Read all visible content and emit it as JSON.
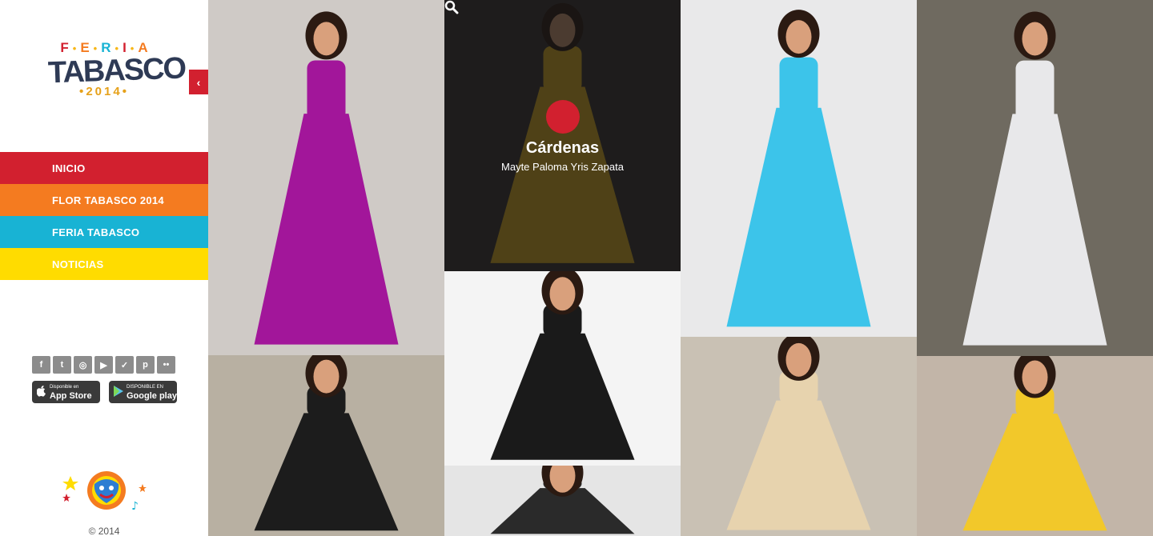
{
  "logo": {
    "feria_letters": [
      "F",
      "E",
      "R",
      "I",
      "A"
    ],
    "feria_colors": [
      "#d2202f",
      "#f47b20",
      "#18b3d4",
      "#d2202f",
      "#f47b20"
    ],
    "title": "TABASCO",
    "year": "2014"
  },
  "sidebar": {
    "collapse_icon": "‹",
    "nav": [
      {
        "label": "INICIO",
        "color": "#d2202f"
      },
      {
        "label": "FLOR TABASCO 2014",
        "color": "#f47b20"
      },
      {
        "label": "FERIA TABASCO",
        "color": "#18b3d4"
      },
      {
        "label": "NOTICIAS",
        "color": "#ffdc00"
      }
    ],
    "socials": [
      {
        "name": "facebook-icon",
        "glyph": "f"
      },
      {
        "name": "twitter-icon",
        "glyph": "t"
      },
      {
        "name": "instagram-icon",
        "glyph": "◎"
      },
      {
        "name": "youtube-icon",
        "glyph": "▶"
      },
      {
        "name": "foursquare-icon",
        "glyph": "✓"
      },
      {
        "name": "pinterest-icon",
        "glyph": "p"
      },
      {
        "name": "flickr-icon",
        "glyph": "••"
      }
    ],
    "stores": [
      {
        "small": "Disponible en",
        "big": "App Store",
        "icon": ""
      },
      {
        "small": "DISPONIBLE EN",
        "big": "Google play",
        "icon": "▶"
      }
    ],
    "copyright": "© 2014"
  },
  "gallery": {
    "hovered": {
      "title": "Cárdenas",
      "subtitle": "Mayte Paloma Yris Zapata",
      "icon": "search-icon"
    },
    "tiles": [
      {
        "dress": "#a2169a",
        "bg": "#cfcac6"
      },
      {
        "dress": "#e8b820",
        "bg": "#3a3532"
      },
      {
        "dress": "#3cc4ea",
        "bg": "#e9e9ea"
      },
      {
        "dress": "#e8e8ea",
        "bg": "#6f6a60"
      },
      {
        "dress": "#1c1c1c",
        "bg": "#b8b0a2"
      },
      {
        "dress": "#1a1a1a",
        "bg": "#f4f4f4"
      },
      {
        "dress": "#e7d3ae",
        "bg": "#c9c1b4"
      },
      {
        "dress": "#f2c82a",
        "bg": "#c2b5a8"
      },
      {
        "dress": "#2a2a2a",
        "bg": "#e5e5e5"
      }
    ]
  }
}
